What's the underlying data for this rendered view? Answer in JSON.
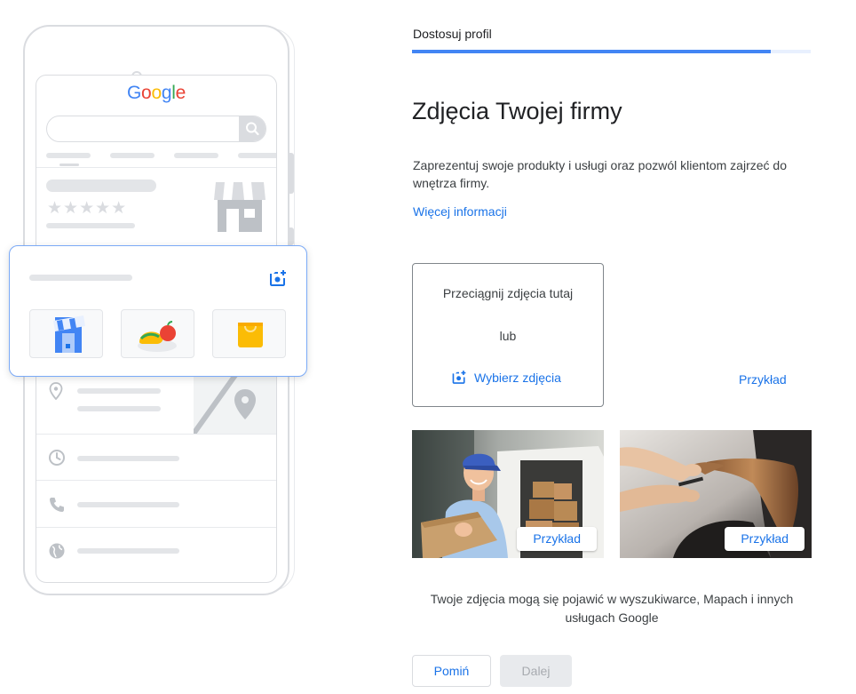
{
  "phone": {
    "logo_letters": [
      {
        "char": "G",
        "color": "#4285f4"
      },
      {
        "char": "o",
        "color": "#ea4335"
      },
      {
        "char": "o",
        "color": "#fbbc05"
      },
      {
        "char": "g",
        "color": "#4285f4"
      },
      {
        "char": "l",
        "color": "#34a853"
      },
      {
        "char": "e",
        "color": "#ea4335"
      }
    ],
    "stars": "★★★★★",
    "icons": [
      "search-icon",
      "storefront-icon",
      "location-pin-icon",
      "map-icon",
      "clock-icon",
      "phone-icon",
      "globe-icon",
      "add-photo-icon"
    ]
  },
  "header": {
    "step_label": "Dostosuj profil",
    "progress_fraction": 0.9
  },
  "main": {
    "title": "Zdjęcia Twojej firmy",
    "description": "Zaprezentuj swoje produkty i usługi oraz pozwól klientom zajrzeć do wnętrza firmy.",
    "more_info_link": "Więcej informacji"
  },
  "upload": {
    "drag_text": "Przeciągnij zdjęcia tutaj",
    "or_text": "lub",
    "choose_label": "Wybierz zdjęcia",
    "example_link": "Przykład"
  },
  "examples": [
    {
      "label": "Przykład",
      "subject": "delivery-worker-photo"
    },
    {
      "label": "Przykład",
      "subject": "hairdresser-photo"
    }
  ],
  "caption": "Twoje zdjęcia mogą się pojawić w wyszukiwarce, Mapach i innych usługach Google",
  "buttons": {
    "skip": "Pomiń",
    "next": "Dalej"
  },
  "colors": {
    "accent": "#1a73e8",
    "progress": "#4285f4",
    "disabled_bg": "#e8eaed"
  }
}
